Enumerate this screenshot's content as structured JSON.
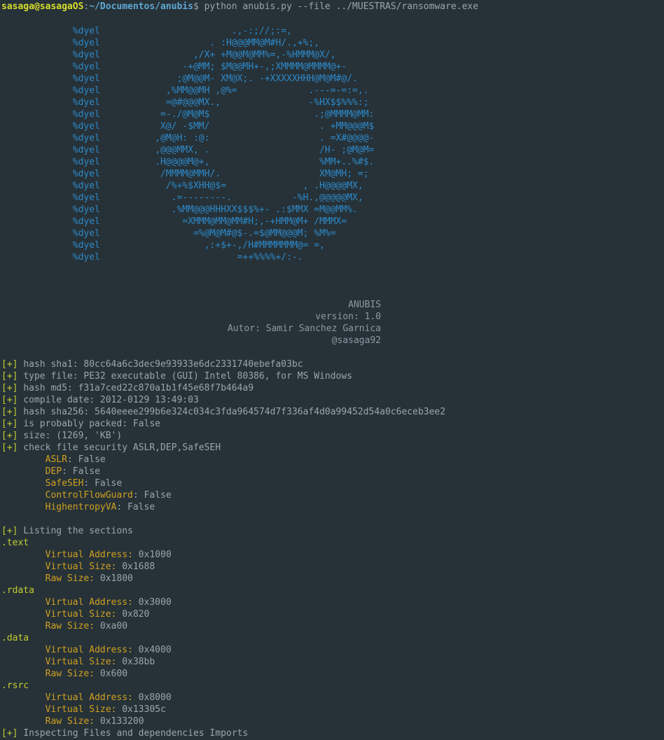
{
  "prompt": {
    "user": "sasaga@sasagaOS",
    "sep": ":",
    "path": "~/Documentos/anubis",
    "symbol": "$",
    "command": "python anubis.py --file ../MUESTRAS/ransomware.exe"
  },
  "ascii_art": {
    "prefix": "%dyel",
    "lines": [
      "                        .,-:;//;:=,",
      "                    . :H@@@MM@M#H/.,+%;,",
      "                 ,/X+ +M@@M@MM%=,-%HMMM@X/,",
      "               -+@MM; $M@@MH+-,;XMMMM@MMMM@+-",
      "              ;@M@@M- XM@X;. -+XXXXXHHH@M@M#@/.",
      "            ,%MM@@MH ,@%=             .---=-=:=,.",
      "            =@#@@@MX.,                -%HX$$%%%:;",
      "           =-./@M@M$                   .;@MMMM@MM:",
      "           X@/ -$MM/                    . +MM@@@M$",
      "          ,@M@H: :@:                    . =X#@@@@-",
      "          ,@@@MMX, .                    /H- ;@M@M=",
      "          .H@@@@M@+,                    %MM+..%#$.",
      "           /MMMM@MMH/.                  XM@MH; =;",
      "            /%+%$XHH@$=              , .H@@@@MX,",
      "             .=--------.           -%H.,@@@@@MX,",
      "             .%MM@@@HHHXX$$$%+- .:$MMX =M@@MM%.",
      "               =XMMM@MM@MM#H;,-+HMM@M+ /MMMX=",
      "                 =%@M@M#@$-.=$@MM@@@M; %M%=",
      "                   ,:+$+-,/H#MMMMMMM@= =,",
      "                         =++%%%%+/:-."
    ]
  },
  "banner": {
    "name": "ANUBIS",
    "version": "version: 1.0",
    "author": "Autor: Samir Sanchez Garnica",
    "handle": "@sasaga92"
  },
  "tag": "[+]",
  "info": [
    "hash sha1: 80cc64a6c3dec9e93933e6dc2331740ebefa03bc",
    "type file: PE32 executable (GUI) Intel 80386, for MS Windows",
    "hash md5: f31a7ced22c870a1b1f45e68f7b464a9",
    "compile date: 2012-0129 13:49:03",
    "hash sha256: 5640eeee299b6e324c034c3fda964574d7f336af4d0a99452d54a0c6eceb3ee2",
    "is probably packed: False",
    "size: (1269, 'KB')",
    "check file security ASLR,DEP,SafeSEH"
  ],
  "security": [
    {
      "key": "ASLR",
      "value": " False"
    },
    {
      "key": "DEP",
      "value": " False"
    },
    {
      "key": "SafeSEH",
      "value": " False"
    },
    {
      "key": "ControlFlowGuard",
      "value": " False"
    },
    {
      "key": "HighentropyVA",
      "value": " False"
    }
  ],
  "sections_header": "Listing the sections",
  "sections": [
    {
      "name": ".text",
      "va": " 0x1000",
      "vs": " 0x1688",
      "raw": " 0x1800"
    },
    {
      "name": ".rdata",
      "va": " 0x3000",
      "vs": " 0x820",
      "raw": " 0xa00"
    },
    {
      "name": ".data",
      "va": " 0x4000",
      "vs": " 0x38bb",
      "raw": " 0x600"
    },
    {
      "name": ".rsrc",
      "va": " 0x8000",
      "vs": " 0x13305c",
      "raw": " 0x133200"
    }
  ],
  "field_labels": {
    "va": "Virtual Address:",
    "vs": "Virtual Size:",
    "raw": "Raw Size:"
  },
  "imports_header": "Inspecting Files and dependencies Imports",
  "colors": {
    "background": "#263238",
    "user": "#d7dd2a",
    "path": "#5fa8d3",
    "art": "#2e88c8",
    "key": "#d1a020",
    "text": "#98a6ad"
  }
}
